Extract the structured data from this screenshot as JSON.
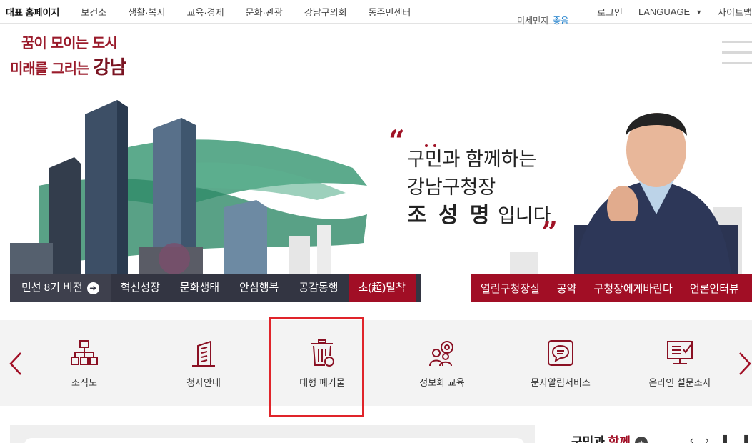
{
  "topbar": {
    "home": "대표 홈페이지",
    "menu": [
      "보건소",
      "생활·복지",
      "교육·경제",
      "문화·관광",
      "강남구의회",
      "동주민센터"
    ],
    "login": "로그인",
    "language": "LANGUAGE",
    "sitemap": "사이트맵"
  },
  "air": {
    "label": "미세먼지",
    "status": "좋음"
  },
  "logo": {
    "line1": "꿈이 모이는 도시",
    "line2a": "미래를 그리는 ",
    "line2b": "강남"
  },
  "hero": {
    "line1": "구민과 함께하는",
    "line2": "강남구청장",
    "name": "조 성 명",
    "suffix": " 입니다",
    "quote_open": "“",
    "quote_close": "”"
  },
  "nav_left": {
    "vision": "민선 8기 비전",
    "items": [
      "혁신성장",
      "문화생태",
      "안심행복",
      "공감동행",
      "초(超)밀착"
    ]
  },
  "nav_right": {
    "items": [
      "열린구청장실",
      "공약",
      "구청장에게바란다",
      "언론인터뷰"
    ]
  },
  "quick": {
    "items": [
      {
        "label": "조직도",
        "icon": "org-chart-icon"
      },
      {
        "label": "청사안내",
        "icon": "building-icon"
      },
      {
        "label": "대형 폐기물",
        "icon": "trash-bin-icon"
      },
      {
        "label": "정보화 교육",
        "icon": "people-gear-icon"
      },
      {
        "label": "문자알림서비스",
        "icon": "message-icon"
      },
      {
        "label": "온라인 설문조사",
        "icon": "survey-monitor-icon"
      }
    ]
  },
  "bottom": {
    "title_a": "구민과 ",
    "title_b": "함께",
    "plus": "+"
  },
  "colors": {
    "accent": "#a10e25",
    "navy": "#333542",
    "highlight": "#e0242a",
    "air_good": "#1e7fcc"
  }
}
